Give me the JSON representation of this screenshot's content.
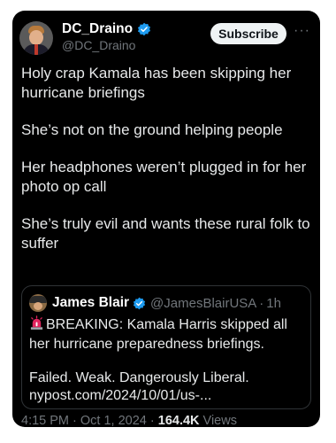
{
  "author": {
    "display_name": "DC_Draino",
    "handle": "@DC_Draino",
    "verified": true
  },
  "actions": {
    "subscribe_label": "Subscribe",
    "more_label": "···"
  },
  "post": {
    "paragraphs": [
      "Holy crap Kamala has been skipping her hurricane briefings",
      "She’s not on the ground helping people",
      "Her headphones weren’t plugged in for her photo op call",
      "She’s truly evil and wants these rural folk to suffer"
    ]
  },
  "quote": {
    "display_name": "James Blair",
    "handle": "@JamesBlairUSA",
    "separator": "·",
    "time": "1h",
    "icon": "police-light-icon",
    "text_line1": "BREAKING: Kamala Harris skipped all her hurricane preparedness briefings.",
    "text_line2": "Failed. Weak. Dangerously Liberal. nypost.com/2024/10/01/us-..."
  },
  "meta": {
    "time": "4:15 PM",
    "sep1": " · ",
    "date": "Oct 1, 2024",
    "sep2": " · ",
    "views_count": "164.4K",
    "views_label": " Views"
  },
  "colors": {
    "background": "#000000",
    "text": "#e7e9ea",
    "muted": "#71767b",
    "verified_blue": "#1d9bf0",
    "border": "#2f3336"
  }
}
